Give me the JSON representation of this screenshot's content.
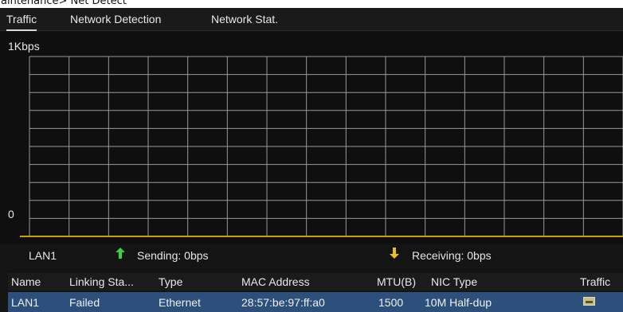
{
  "caption": {
    "text": "aintenance> Net Detect"
  },
  "tabs": [
    {
      "label": "Traffic",
      "active": true
    },
    {
      "label": "Network Detection",
      "active": false
    },
    {
      "label": "Network Stat.",
      "active": false
    }
  ],
  "chart": {
    "y_max_label": "1Kbps",
    "y_min_label": "0",
    "grid_columns": 15,
    "grid_rows": 10,
    "grid_color": "#9a9a9a",
    "baseline_color": "#c8a400"
  },
  "legend": {
    "interface": "LAN1",
    "sending": "Sending: 0bps",
    "receiving": "Receiving: 0bps",
    "sending_color": "#3cd23c",
    "receiving_color": "#e6c21e"
  },
  "table": {
    "headers": [
      "Name",
      "Linking Sta...",
      "Type",
      "MAC Address",
      "MTU(B)",
      "NIC Type",
      "Traffic"
    ],
    "row": {
      "name": "LAN1",
      "linking_status": "Failed",
      "type": "Ethernet",
      "mac_address": "28:57:be:97:ff:a0",
      "mtu": "1500",
      "nic_type": "10M Half-dup",
      "traffic_icon": "traffic-graph-icon"
    },
    "selected_row_color": "#2d4f7c"
  }
}
